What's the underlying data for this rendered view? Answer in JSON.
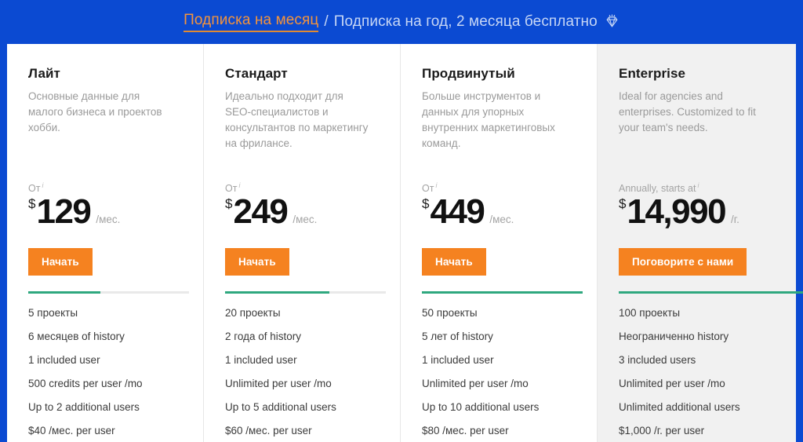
{
  "billing": {
    "monthly_label": "Подписка на месяц",
    "separator": "/",
    "annual_label": "Подписка на год, 2 месяца бесплатно",
    "gem_icon": "diamond-icon",
    "active_color": "#f5943b",
    "inactive_color": "#c6d6f5",
    "background_color": "#0b4ad2"
  },
  "theme": {
    "accent_orange": "#f58220",
    "brand_blue": "#0b4ad2",
    "progress_green": "#2fa87f",
    "enterprise_bg": "#f1f1f1"
  },
  "plans": [
    {
      "name": "Лайт",
      "description": "Основные данные для малого бизнеса и проектов хобби.",
      "price_prefix": "От",
      "info_marker": "i",
      "currency": "$",
      "amount": "129",
      "period": "/мес.",
      "cta_label": "Начать",
      "progress_percent": 45,
      "features": [
        "5 проекты",
        "6 месяцев of history",
        "1 included user",
        "500 credits per user /mo",
        "Up to 2 additional users",
        "$40 /мес. per user"
      ]
    },
    {
      "name": "Стандарт",
      "description": "Идеально подходит для SEO-специалистов и консультантов по маркетингу на фрилансе.",
      "price_prefix": "От",
      "info_marker": "i",
      "currency": "$",
      "amount": "249",
      "period": "/мес.",
      "cta_label": "Начать",
      "progress_percent": 65,
      "features": [
        "20 проекты",
        "2 года of history",
        "1 included user",
        "Unlimited per user /mo",
        "Up to 5 additional users",
        "$60 /мес. per user"
      ]
    },
    {
      "name": "Продвинутый",
      "description": "Больше инструментов и данных для упорных внутренних маркетинговых команд.",
      "price_prefix": "От",
      "info_marker": "i",
      "currency": "$",
      "amount": "449",
      "period": "/мес.",
      "cta_label": "Начать",
      "progress_percent": 100,
      "features": [
        "50 проекты",
        "5 лет of history",
        "1 included user",
        "Unlimited per user /mo",
        "Up to 10 additional users",
        "$80 /мес. per user"
      ]
    },
    {
      "name": "Enterprise",
      "description": "Ideal for agencies and enterprises. Customized to fit your team's needs.",
      "price_prefix": "Annually, starts at",
      "info_marker": "i",
      "currency": "$",
      "amount": "14,990",
      "period": "/г.",
      "cta_label": "Поговорите с нами",
      "progress_percent": 100,
      "features": [
        "100 проекты",
        "Неограниченно history",
        "3 included users",
        "Unlimited per user /mo",
        "Unlimited additional users",
        "$1,000 /г. per user"
      ]
    }
  ]
}
